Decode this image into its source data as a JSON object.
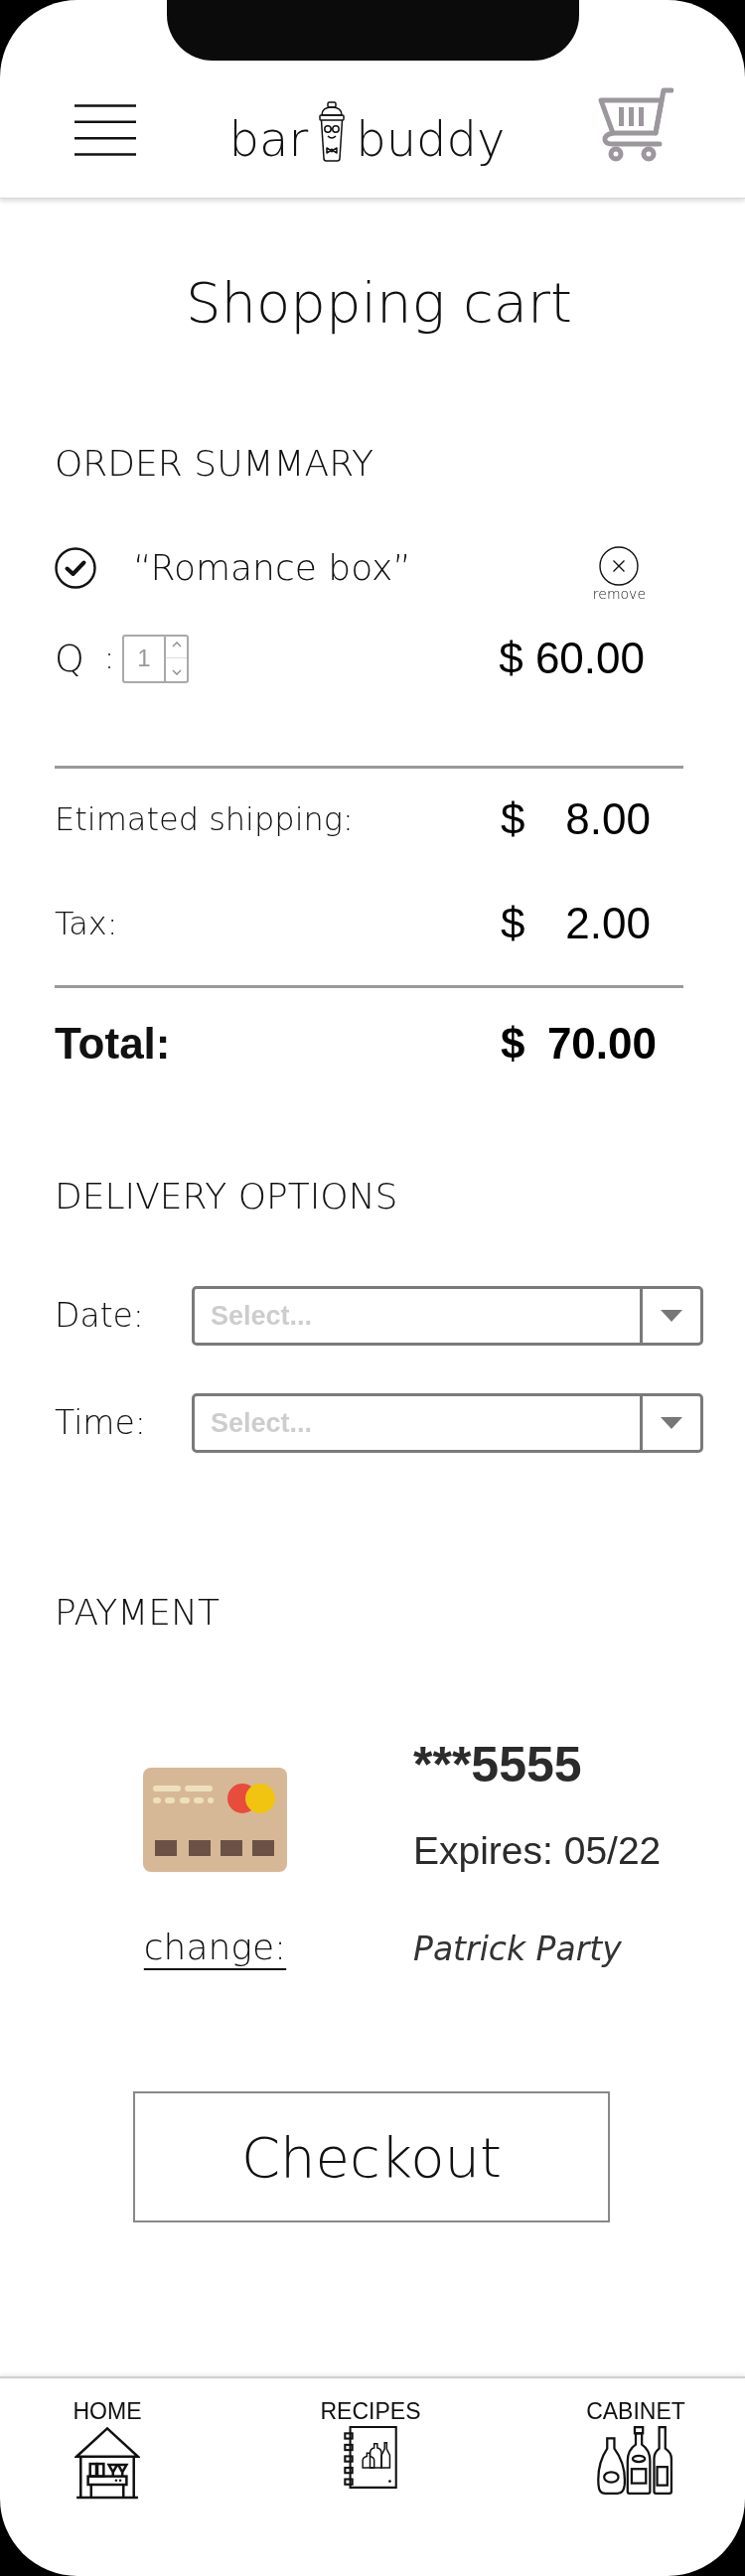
{
  "header": {
    "logo": {
      "left": "bar",
      "right": "buddy"
    }
  },
  "title": "Shopping cart",
  "order_summary": {
    "heading": "ORDER SUMMARY",
    "items": [
      {
        "name": "“Romance box”",
        "checked": true,
        "remove_label": "remove",
        "quantity_label": "Q",
        "separator": ":",
        "quantity": "1",
        "price": "$ 60.00"
      }
    ],
    "lines": [
      {
        "kind": "line",
        "label": "Etimated shipping:",
        "currency": "$",
        "amount": "8.00"
      },
      {
        "kind": "line",
        "label": "Tax:",
        "currency": "$",
        "amount": "2.00"
      },
      {
        "kind": "total",
        "label": "Total:",
        "currency": "$",
        "amount": "70.00"
      }
    ]
  },
  "delivery_options": {
    "heading": "DELIVERY OPTIONS",
    "fields": [
      {
        "label": "Date:",
        "placeholder": "Select..."
      },
      {
        "label": "Time:",
        "placeholder": "Select..."
      }
    ]
  },
  "payment": {
    "heading": "PAYMENT",
    "card_number": "***5555",
    "expires": "Expires: 05/22",
    "change_link": "change:",
    "cardholder": "Patrick Party"
  },
  "checkout_button": "Checkout",
  "bottom_nav": [
    {
      "label": "HOME"
    },
    {
      "label": "RECIPES"
    },
    {
      "label": "CABINET"
    }
  ]
}
